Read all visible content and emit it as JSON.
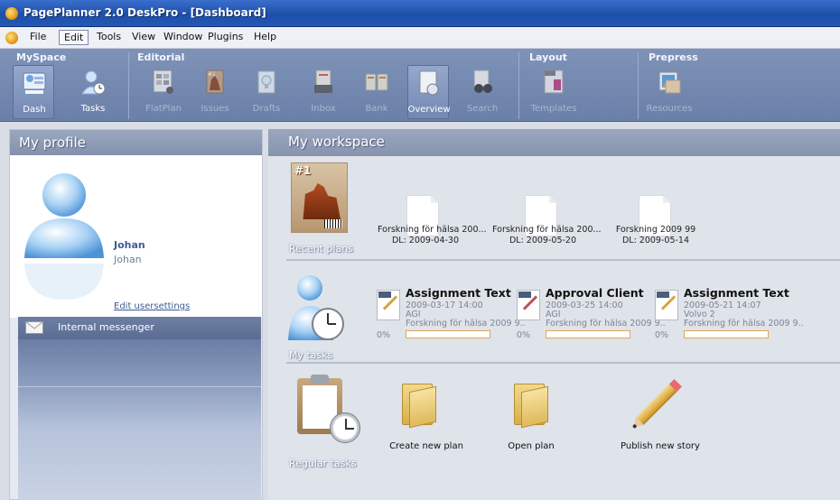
{
  "window": {
    "title": "PagePlanner 2.0 DeskPro - [Dashboard]"
  },
  "menu": [
    {
      "label": "File"
    },
    {
      "label": "Edit",
      "active": true
    },
    {
      "label": "Tools"
    },
    {
      "label": "View"
    },
    {
      "label": "Window"
    },
    {
      "label": "Plugins"
    },
    {
      "label": "Help"
    }
  ],
  "ribbon": {
    "groups": {
      "myspace": "MySpace",
      "editorial": "Editorial",
      "layout": "Layout",
      "prepress": "Prepress"
    },
    "buttons": {
      "dash": "Dash",
      "tasks": "Tasks",
      "flatplan": "FlatPlan",
      "issues": "Issues",
      "drafts": "Drafts",
      "inbox": "Inbox",
      "bank": "Bank",
      "overview": "Overview",
      "search": "Search",
      "templates": "Templates",
      "resources": "Resources"
    }
  },
  "profile": {
    "header": "My profile",
    "name": "Johan",
    "subname": "Johan",
    "edit_link": "Edit usersettings",
    "messenger": "Internal messenger"
  },
  "workspace": {
    "header": "My workspace",
    "recent_plans": {
      "label": "Recent plans",
      "items": [
        {
          "title": "Forskning för hälsa 200...",
          "deadline": "DL: 2009-04-30"
        },
        {
          "title": "Forskning för hälsa 200...",
          "deadline": "DL: 2009-05-20"
        },
        {
          "title": "Forskning 2009 99",
          "deadline": "DL: 2009-05-14"
        }
      ]
    },
    "my_tasks": {
      "label": "My tasks",
      "items": [
        {
          "title": "Assignment Text",
          "date": "2009-03-17 14:00",
          "owner": "AGI",
          "plan": "Forskning för hälsa 2009 9..",
          "percent": "0%",
          "progress": 0
        },
        {
          "title": "Approval Client",
          "date": "2009-03-25 14:00",
          "owner": "AGI",
          "plan": "Forskning för hälsa 2009 9..",
          "percent": "0%",
          "progress": 0
        },
        {
          "title": "Assignment Text",
          "date": "2009-05-21 14:07",
          "owner": "Volvo 2",
          "plan": "Forskning för hälsa 2009 9..",
          "percent": "0%",
          "progress": 0
        }
      ]
    },
    "regular_tasks": {
      "label": "Regular tasks",
      "actions": {
        "create": "Create new plan",
        "open": "Open plan",
        "publish": "Publish new story"
      }
    }
  },
  "colors": {
    "ribbon": "#7386ad",
    "panel_header": "#8d9ab5",
    "accent_link": "#3c5c94",
    "progress_border": "#e0a55a"
  }
}
